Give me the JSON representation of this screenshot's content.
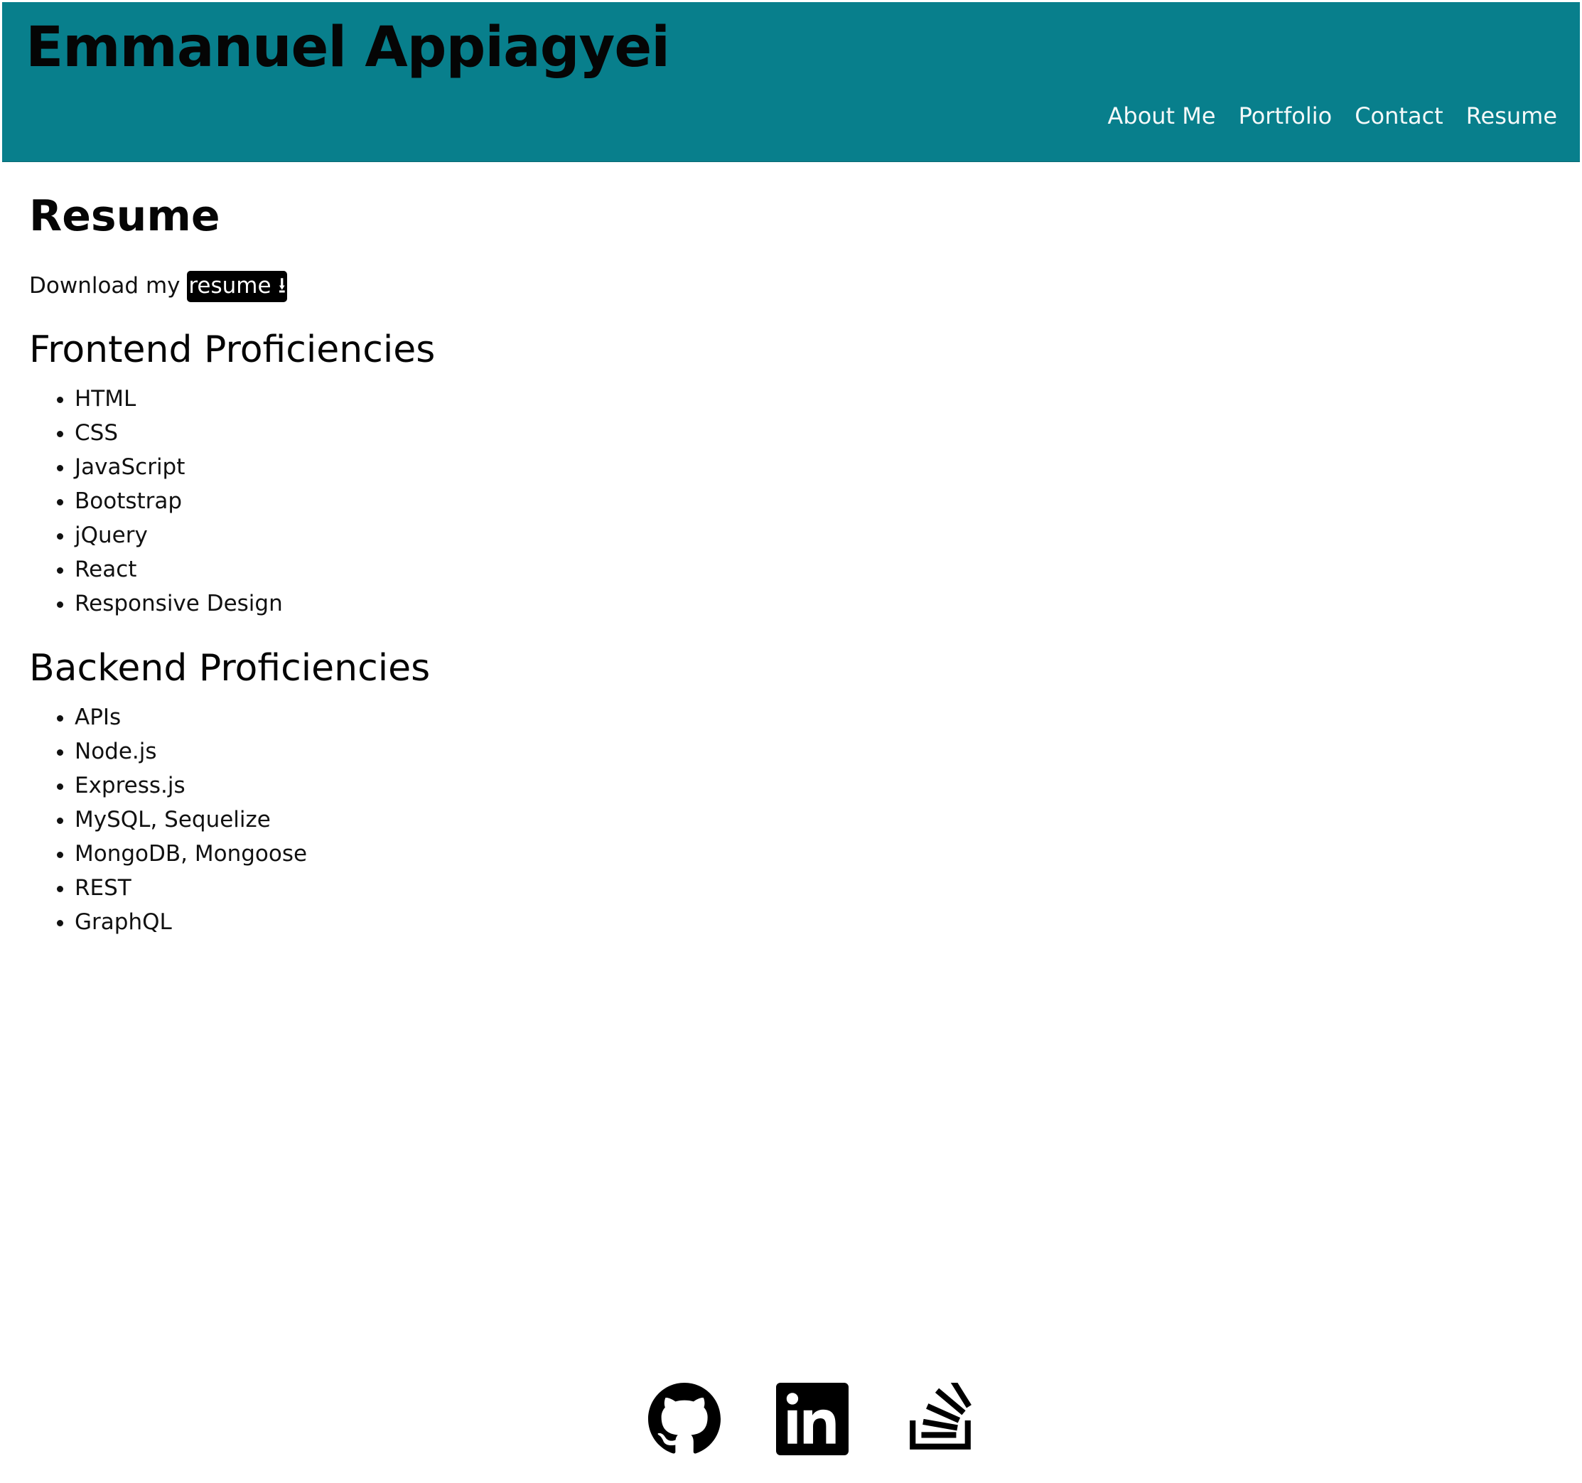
{
  "header": {
    "site_title": "Emmanuel Appiagyei",
    "nav": [
      {
        "label": "About Me"
      },
      {
        "label": "Portfolio"
      },
      {
        "label": "Contact"
      },
      {
        "label": "Resume"
      }
    ]
  },
  "main": {
    "heading": "Resume",
    "download_prefix": "Download my ",
    "download_link_label": "resume ⭳",
    "frontend": {
      "heading": "Frontend Proficiencies",
      "items": [
        "HTML",
        "CSS",
        "JavaScript",
        "Bootstrap",
        "jQuery",
        "React",
        "Responsive Design"
      ]
    },
    "backend": {
      "heading": "Backend Proficiencies",
      "items": [
        "APIs",
        "Node.js",
        "Express.js",
        "MySQL, Sequelize",
        "MongoDB, Mongoose",
        "REST",
        "GraphQL"
      ]
    }
  },
  "footer": {
    "icons": [
      "github-icon",
      "linkedin-icon",
      "stackoverflow-icon"
    ]
  },
  "colors": {
    "header_bg": "#087f8c",
    "nav_text": "#f4f9f9",
    "link_bg": "#000000"
  }
}
